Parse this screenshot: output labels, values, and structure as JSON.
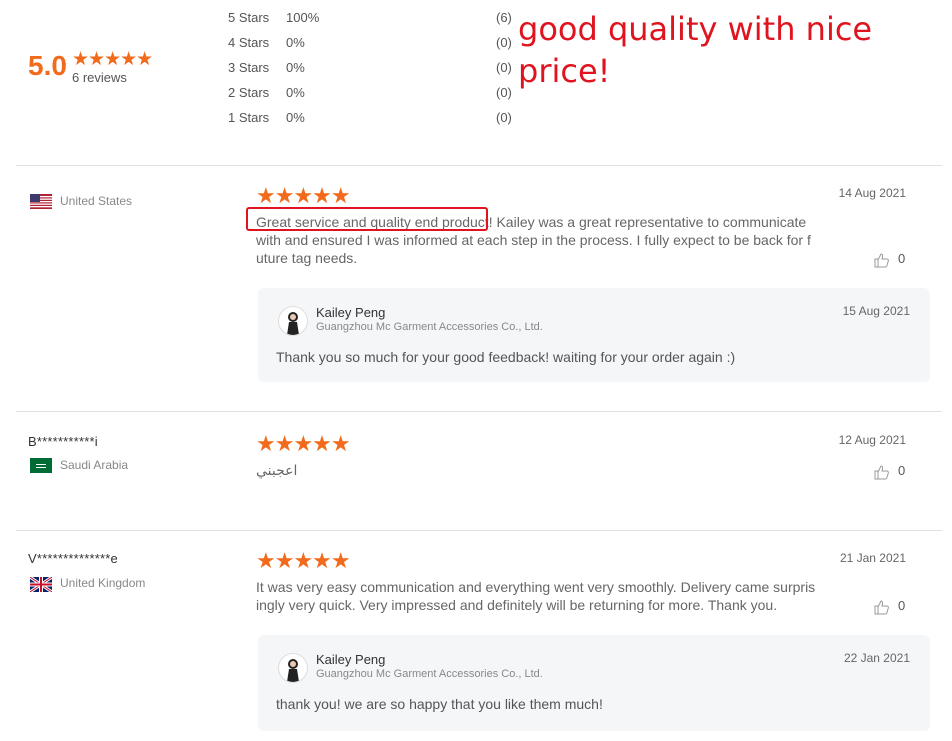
{
  "summary": {
    "score": "5.0",
    "stars": "★★★★★",
    "review_count": "6 reviews",
    "distribution": [
      {
        "label": "5  Stars",
        "percent": "100%",
        "count": "(6)"
      },
      {
        "label": "4  Stars",
        "percent": "0%",
        "count": "(0)"
      },
      {
        "label": "3  Stars",
        "percent": "0%",
        "count": "(0)"
      },
      {
        "label": "2  Stars",
        "percent": "0%",
        "count": "(0)"
      },
      {
        "label": "1  Stars",
        "percent": "0%",
        "count": "(0)"
      }
    ]
  },
  "annotation": {
    "text": "good quality with nice price!",
    "color": "#e0141e"
  },
  "accent_color": "#f26a1b",
  "reviews": [
    {
      "buyer": "",
      "country": "United States",
      "flag": "us-flag-icon",
      "stars": "★★★★★",
      "date": "14 Aug 2021",
      "text": "Great service and quality end product! Kailey was a great representative to communicate with and ensured I was informed at each step in the process. I fully expect to be back for future tag needs.",
      "likes": "0",
      "reply": {
        "seller_name": "Kailey Peng",
        "company": "Guangzhou Mc Garment Accessories Co., Ltd.",
        "date": "15 Aug 2021",
        "text": "Thank you so much for your good feedback! waiting for your order again :)"
      }
    },
    {
      "buyer": "B***********i",
      "country": "Saudi Arabia",
      "flag": "saudi-flag-icon",
      "stars": "★★★★★",
      "date": "12 Aug 2021",
      "text": "اعجبني",
      "likes": "0"
    },
    {
      "buyer": "V**************e",
      "country": "United Kingdom",
      "flag": "uk-flag-icon",
      "stars": "★★★★★",
      "date": "21 Jan 2021",
      "text": "It was very easy communication and everything went very smoothly. Delivery came surprisingly very quick. Very impressed and definitely will be returning for more. Thank you.",
      "likes": "0",
      "reply": {
        "seller_name": "Kailey Peng",
        "company": "Guangzhou Mc Garment Accessories Co., Ltd.",
        "date": "22 Jan 2021",
        "text": "thank you! we are so happy that you like them much!"
      }
    }
  ]
}
